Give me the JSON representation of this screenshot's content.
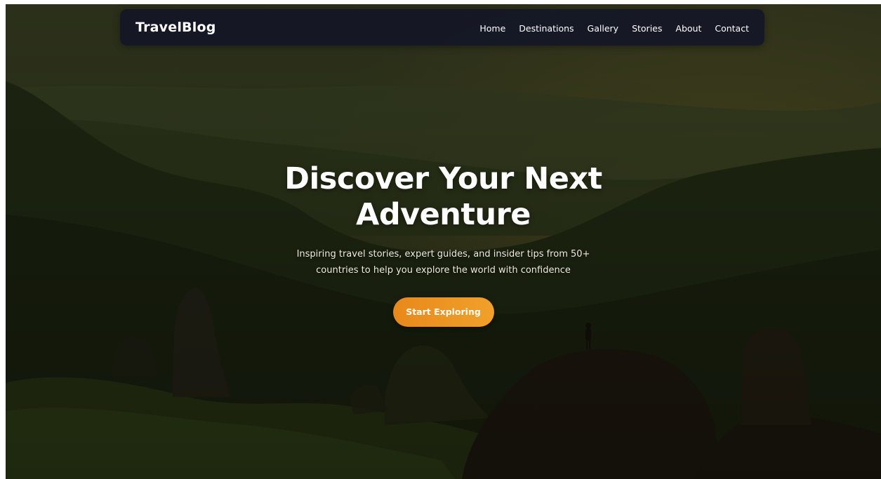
{
  "nav": {
    "brand": "TravelBlog",
    "links": [
      "Home",
      "Destinations",
      "Gallery",
      "Stories",
      "About",
      "Contact"
    ]
  },
  "hero": {
    "title_line1": "Discover Your Next",
    "title_line2": "Adventure",
    "subtitle": "Inspiring travel stories, expert guides, and insider tips from 50+ countries to help you explore the world with confidence",
    "cta_label": "Start Exploring"
  },
  "colors": {
    "nav_background": "#141626",
    "cta_start": "#e8881c",
    "cta_end": "#f0a12a",
    "text_white": "#ffffff"
  }
}
